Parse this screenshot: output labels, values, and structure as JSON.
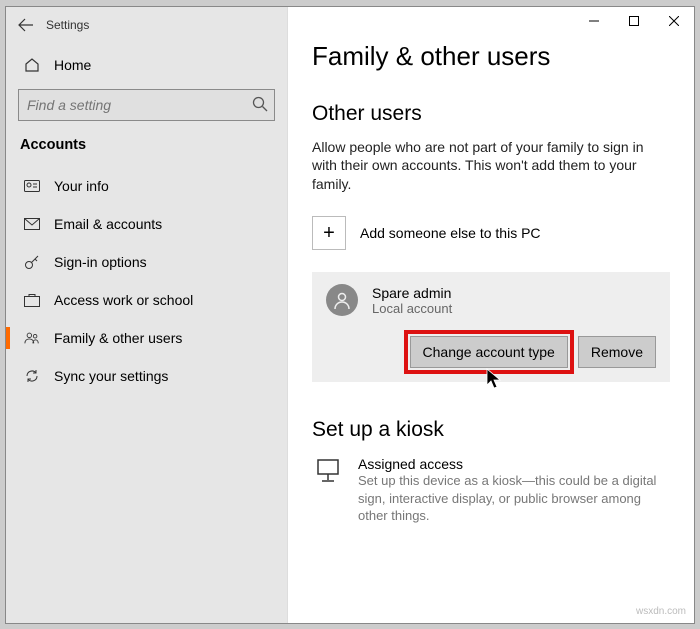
{
  "app": {
    "title": "Settings"
  },
  "sidebar": {
    "home": "Home",
    "search_placeholder": "Find a setting",
    "category": "Accounts",
    "items": [
      {
        "label": "Your info"
      },
      {
        "label": "Email & accounts"
      },
      {
        "label": "Sign-in options"
      },
      {
        "label": "Access work or school"
      },
      {
        "label": "Family & other users"
      },
      {
        "label": "Sync your settings"
      }
    ]
  },
  "main": {
    "title": "Family & other users",
    "other_users_heading": "Other users",
    "other_users_desc": "Allow people who are not part of your family to sign in with their own accounts. This won't add them to your family.",
    "add_label": "Add someone else to this PC",
    "user": {
      "name": "Spare admin",
      "type": "Local account"
    },
    "change_btn": "Change account type",
    "remove_btn": "Remove",
    "kiosk_heading": "Set up a kiosk",
    "kiosk_title": "Assigned access",
    "kiosk_desc": "Set up this device as a kiosk—this could be a digital sign, interactive display, or public browser among other things."
  },
  "watermark": "wsxdn.com"
}
